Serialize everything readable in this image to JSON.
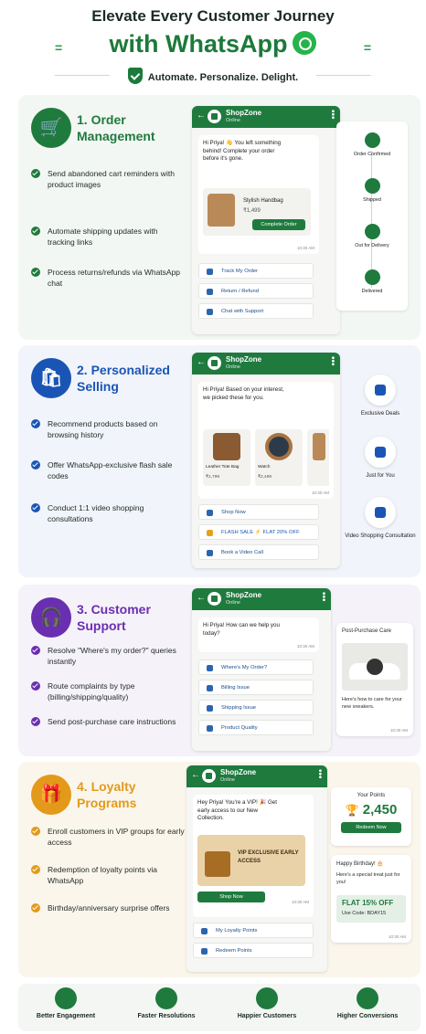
{
  "header": {
    "title_line1": "Elevate Every Customer Journey",
    "title_line2": "with WhatsApp",
    "tagline": "Automate. Personalize. Delight."
  },
  "colors": {
    "green": "#1f7a3e",
    "blue": "#1a55b5",
    "purple": "#6a2fb0",
    "orange": "#e39a1a"
  },
  "sections": [
    {
      "title": "1. Order Management",
      "bullets": [
        "Send abandoned cart reminders with product images",
        "Automate shipping updates with tracking links",
        "Process returns/refunds via WhatsApp chat"
      ],
      "chat": {
        "store": "ShopZone",
        "status": "Online",
        "message": "Hi Priya! 👋 You left something behind! Complete your order before it's gone.",
        "product_name": "Stylish Handbag",
        "product_price": "₹1,499",
        "cta": "Complete Order",
        "time": "10:30 AM",
        "buttons": [
          "Track My Order",
          "Return / Refund",
          "Chat with Support"
        ]
      },
      "tracker": [
        "Order Confirmed",
        "Shipped",
        "Out for Delivery",
        "Delivered"
      ]
    },
    {
      "title": "2. Personalized Selling",
      "bullets": [
        "Recommend products based on browsing history",
        "Offer WhatsApp-exclusive flash sale codes",
        "Conduct 1:1 video shopping consultations"
      ],
      "chat": {
        "store": "ShopZone",
        "status": "Online",
        "message": "Hi Priya! Based on your interest, we picked these for you.",
        "products": [
          {
            "name": "Leather Tote Bag",
            "price": "₹1,799"
          },
          {
            "name": "Watch",
            "price": "₹2,499"
          }
        ],
        "time": "10:30 AM",
        "buttons": [
          "Shop Now",
          "FLASH SALE ⚡ FLAT 20% OFF",
          "Book a Video Call"
        ]
      },
      "features": [
        "Exclusive Deals",
        "Just for You",
        "Video Shopping Consultation"
      ]
    },
    {
      "title": "3. Customer Support",
      "bullets": [
        "Resolve \"Where's my order?\" queries instantly",
        "Route complaints by type (billing/shipping/quality)",
        "Send post-purchase care instructions"
      ],
      "chat": {
        "store": "ShopZone",
        "status": "Online",
        "message": "Hi Priya! How can we help you today?",
        "time": "10:30 AM",
        "buttons": [
          "Where's My Order?",
          "Billing Issue",
          "Shipping Issue",
          "Product Quality"
        ]
      },
      "care": {
        "title": "Post-Purchase Care",
        "text": "Here's how to care for your new sneakers.",
        "time": "10:30 AM"
      }
    },
    {
      "title": "4. Loyalty Programs",
      "bullets": [
        "Enroll customers in VIP groups for early access",
        "Redemption of loyalty points via WhatsApp",
        "Birthday/anniversary surprise offers"
      ],
      "chat": {
        "store": "ShopZone",
        "status": "Online",
        "message": "Hey Priya! You're a VIP! 🎉 Get early access to our New Collection.",
        "banner": "VIP EXCLUSIVE EARLY ACCESS",
        "cta": "Shop Now",
        "time": "10:30 AM",
        "buttons": [
          "My Loyalty Points",
          "Redeem Points"
        ]
      },
      "points": {
        "label": "Your Points",
        "value": "2,450",
        "cta": "Redeem Now"
      },
      "birthday": {
        "title": "Happy Birthday! 🎂",
        "text": "Here's a special treat just for you!",
        "offer": "FLAT 15% OFF",
        "code": "Use Code: BDAY15",
        "time": "10:30 AM"
      }
    }
  ],
  "footer": [
    "Better Engagement",
    "Faster Resolutions",
    "Happier Customers",
    "Higher Conversions"
  ]
}
